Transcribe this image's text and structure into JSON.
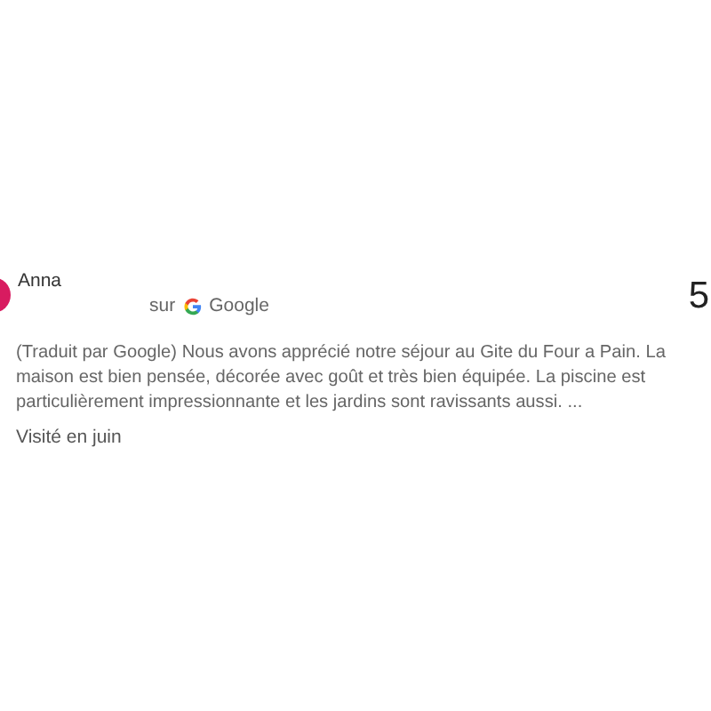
{
  "review": {
    "author": "Anna",
    "source_prefix": "sur",
    "source": "Google",
    "rating_digit": "5",
    "text": "(Traduit par Google) Nous avons apprécié notre séjour au Gite du Four a Pain. La maison est bien pensée, décorée avec goût et très bien équipée. La piscine est particulièrement impressionnante et les jardins sont ravissants aussi. ...",
    "visited": "Visité en juin"
  }
}
